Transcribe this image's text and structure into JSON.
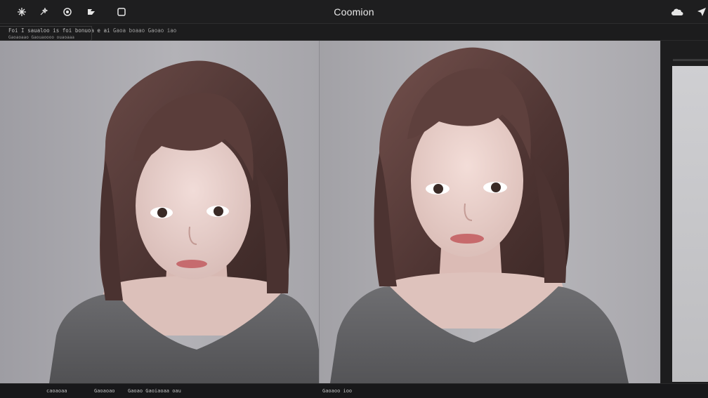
{
  "app": {
    "title": "Coomion"
  },
  "top_icons": [
    {
      "name": "sparkle-icon",
      "glyph": "✲"
    },
    {
      "name": "magic-wand-icon",
      "glyph": "⤫"
    },
    {
      "name": "target-icon",
      "glyph": "◎"
    },
    {
      "name": "layers-icon",
      "glyph": "▞"
    },
    {
      "name": "square-icon",
      "glyph": "▢"
    }
  ],
  "top_right_icons": [
    {
      "name": "cloud-icon",
      "glyph": "☁"
    },
    {
      "name": "send-icon",
      "glyph": "➤"
    }
  ],
  "toolbar": {
    "line1": "Foi I saualoo is foi bonuoa e ai",
    "line2": "Gaoaoaao  Gaouaoooo  ouaoaaa",
    "center_text": "Gaoa boaao  Gaoao iao"
  },
  "bottom_bar": {
    "left": "caoaoaa",
    "mid1": "Gaoaoao",
    "mid2": "Gaoao Gaoiaoaa oau",
    "right": "Gaoaoo ioo"
  }
}
